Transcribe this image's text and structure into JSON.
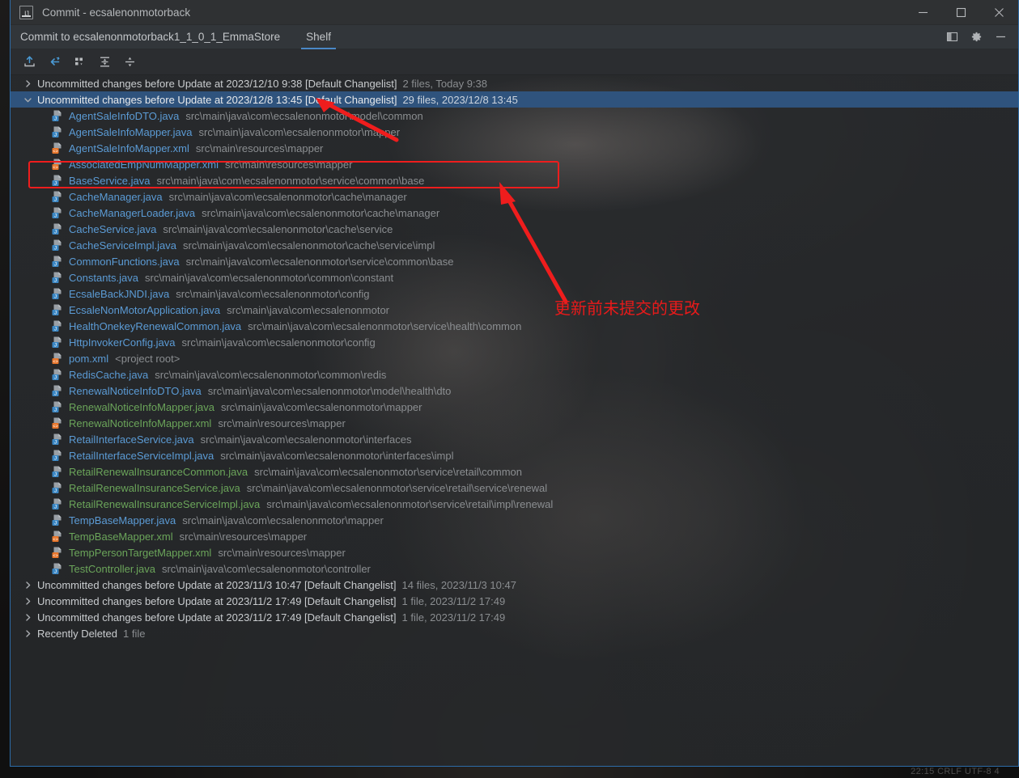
{
  "window": {
    "title": "Commit - ecsalenonmotorback",
    "logo_text": "IJ",
    "minimize_label": "Minimize",
    "maximize_label": "Maximize",
    "close_label": "Close"
  },
  "tabs": {
    "commit_to_label": "Commit to ecsalenonmotorback1_1_0_1_EmmaStore",
    "shelf_label": "Shelf",
    "layout_icon": "layout-settings-icon",
    "gear_icon": "gear-icon",
    "hide_icon": "hide-icon"
  },
  "toolbar": {
    "buttons": [
      {
        "name": "shelve-silently-button",
        "icon": "shelve-upload-icon"
      },
      {
        "name": "unshelve-button",
        "icon": "unshelve-arrow-icon"
      },
      {
        "name": "group-by-button",
        "icon": "group-by-icon"
      },
      {
        "name": "expand-all-button",
        "icon": "expand-all-icon"
      },
      {
        "name": "collapse-all-button",
        "icon": "collapse-all-icon"
      }
    ]
  },
  "annotations": {
    "note_text": "更新前未提交的更改",
    "highlight_color": "#ef1d1d"
  },
  "status_bar": {
    "text": "22:15    CRLF    UTF-8    4"
  },
  "changelists": [
    {
      "title": "Uncommitted changes before Update at 2023/12/10 9:38 [Default Changelist]",
      "meta": "2 files, Today 9:38",
      "expanded": false,
      "selected": false,
      "files": []
    },
    {
      "title": "Uncommitted changes before Update at 2023/12/8 13:45 [Default Changelist]",
      "meta": "29 files, 2023/12/8 13:45",
      "expanded": true,
      "selected": true,
      "files": [
        {
          "name": "AgentSaleInfoDTO.java",
          "path": "src\\main\\java\\com\\ecsalenonmotor\\model\\common",
          "type": "java",
          "status": "mod"
        },
        {
          "name": "AgentSaleInfoMapper.java",
          "path": "src\\main\\java\\com\\ecsalenonmotor\\mapper",
          "type": "java",
          "status": "mod"
        },
        {
          "name": "AgentSaleInfoMapper.xml",
          "path": "src\\main\\resources\\mapper",
          "type": "xml",
          "status": "mod"
        },
        {
          "name": "AssociatedEmpNumMapper.xml",
          "path": "src\\main\\resources\\mapper",
          "type": "xml",
          "status": "mod"
        },
        {
          "name": "BaseService.java",
          "path": "src\\main\\java\\com\\ecsalenonmotor\\service\\common\\base",
          "type": "java",
          "status": "mod"
        },
        {
          "name": "CacheManager.java",
          "path": "src\\main\\java\\com\\ecsalenonmotor\\cache\\manager",
          "type": "java",
          "status": "mod"
        },
        {
          "name": "CacheManagerLoader.java",
          "path": "src\\main\\java\\com\\ecsalenonmotor\\cache\\manager",
          "type": "java",
          "status": "mod"
        },
        {
          "name": "CacheService.java",
          "path": "src\\main\\java\\com\\ecsalenonmotor\\cache\\service",
          "type": "java",
          "status": "mod"
        },
        {
          "name": "CacheServiceImpl.java",
          "path": "src\\main\\java\\com\\ecsalenonmotor\\cache\\service\\impl",
          "type": "java",
          "status": "mod"
        },
        {
          "name": "CommonFunctions.java",
          "path": "src\\main\\java\\com\\ecsalenonmotor\\service\\common\\base",
          "type": "java",
          "status": "mod"
        },
        {
          "name": "Constants.java",
          "path": "src\\main\\java\\com\\ecsalenonmotor\\common\\constant",
          "type": "java",
          "status": "mod"
        },
        {
          "name": "EcsaleBackJNDI.java",
          "path": "src\\main\\java\\com\\ecsalenonmotor\\config",
          "type": "java",
          "status": "mod"
        },
        {
          "name": "EcsaleNonMotorApplication.java",
          "path": "src\\main\\java\\com\\ecsalenonmotor",
          "type": "java",
          "status": "mod"
        },
        {
          "name": "HealthOnekeyRenewalCommon.java",
          "path": "src\\main\\java\\com\\ecsalenonmotor\\service\\health\\common",
          "type": "java",
          "status": "mod"
        },
        {
          "name": "HttpInvokerConfig.java",
          "path": "src\\main\\java\\com\\ecsalenonmotor\\config",
          "type": "java",
          "status": "mod"
        },
        {
          "name": "pom.xml",
          "path": "<project root>",
          "type": "xml",
          "status": "mod"
        },
        {
          "name": "RedisCache.java",
          "path": "src\\main\\java\\com\\ecsalenonmotor\\common\\redis",
          "type": "java",
          "status": "mod"
        },
        {
          "name": "RenewalNoticeInfoDTO.java",
          "path": "src\\main\\java\\com\\ecsalenonmotor\\model\\health\\dto",
          "type": "java",
          "status": "mod"
        },
        {
          "name": "RenewalNoticeInfoMapper.java",
          "path": "src\\main\\java\\com\\ecsalenonmotor\\mapper",
          "type": "java",
          "status": "add"
        },
        {
          "name": "RenewalNoticeInfoMapper.xml",
          "path": "src\\main\\resources\\mapper",
          "type": "xml",
          "status": "add"
        },
        {
          "name": "RetailInterfaceService.java",
          "path": "src\\main\\java\\com\\ecsalenonmotor\\interfaces",
          "type": "java",
          "status": "mod"
        },
        {
          "name": "RetailInterfaceServiceImpl.java",
          "path": "src\\main\\java\\com\\ecsalenonmotor\\interfaces\\impl",
          "type": "java",
          "status": "mod"
        },
        {
          "name": "RetailRenewalInsuranceCommon.java",
          "path": "src\\main\\java\\com\\ecsalenonmotor\\service\\retail\\common",
          "type": "java",
          "status": "add"
        },
        {
          "name": "RetailRenewalInsuranceService.java",
          "path": "src\\main\\java\\com\\ecsalenonmotor\\service\\retail\\service\\renewal",
          "type": "java",
          "status": "add"
        },
        {
          "name": "RetailRenewalInsuranceServiceImpl.java",
          "path": "src\\main\\java\\com\\ecsalenonmotor\\service\\retail\\impl\\renewal",
          "type": "java",
          "status": "add"
        },
        {
          "name": "TempBaseMapper.java",
          "path": "src\\main\\java\\com\\ecsalenonmotor\\mapper",
          "type": "java",
          "status": "mod"
        },
        {
          "name": "TempBaseMapper.xml",
          "path": "src\\main\\resources\\mapper",
          "type": "xml",
          "status": "add"
        },
        {
          "name": "TempPersonTargetMapper.xml",
          "path": "src\\main\\resources\\mapper",
          "type": "xml",
          "status": "add"
        },
        {
          "name": "TestController.java",
          "path": "src\\main\\java\\com\\ecsalenonmotor\\controller",
          "type": "java",
          "status": "add"
        }
      ]
    },
    {
      "title": "Uncommitted changes before Update at 2023/11/3 10:47 [Default Changelist]",
      "meta": "14 files, 2023/11/3 10:47",
      "expanded": false,
      "selected": false,
      "files": []
    },
    {
      "title": "Uncommitted changes before Update at 2023/11/2 17:49 [Default Changelist]",
      "meta": "1 file, 2023/11/2 17:49",
      "expanded": false,
      "selected": false,
      "files": []
    },
    {
      "title": "Uncommitted changes before Update at 2023/11/2 17:49 [Default Changelist]",
      "meta": "1 file, 2023/11/2 17:49",
      "expanded": false,
      "selected": false,
      "files": []
    },
    {
      "title": "Recently Deleted",
      "meta": "1 file",
      "expanded": false,
      "selected": false,
      "files": []
    }
  ]
}
